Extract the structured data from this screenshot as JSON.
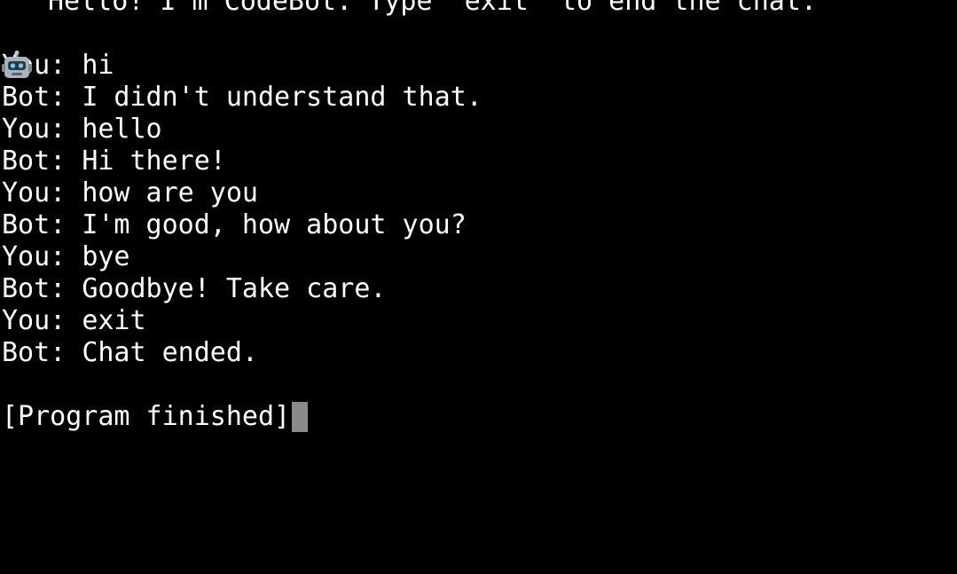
{
  "terminal": {
    "header": {
      "icon": "robot-icon",
      "text": "Hello! I'm CodeBot. Type 'exit' to end the chat."
    },
    "conversation": [
      {
        "speaker": "You: ",
        "text": "hi"
      },
      {
        "speaker": "Bot: ",
        "text": "I didn't understand that."
      },
      {
        "speaker": "You: ",
        "text": "hello"
      },
      {
        "speaker": "Bot: ",
        "text": "Hi there!"
      },
      {
        "speaker": "You: ",
        "text": "how are you"
      },
      {
        "speaker": "Bot: ",
        "text": "I'm good, how about you?"
      },
      {
        "speaker": "You: ",
        "text": "bye"
      },
      {
        "speaker": "Bot: ",
        "text": "Goodbye! Take care."
      },
      {
        "speaker": "You: ",
        "text": "exit"
      },
      {
        "speaker": "Bot: ",
        "text": "Chat ended."
      }
    ],
    "status": "[Program finished]",
    "colors": {
      "background": "#000000",
      "text": "#ffffff",
      "cursor": "#8a8a8a"
    }
  }
}
